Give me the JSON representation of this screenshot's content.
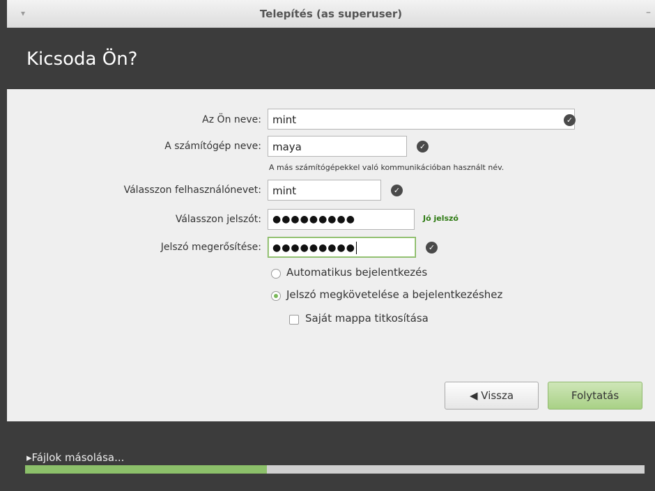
{
  "window": {
    "title": "Telepítés (as superuser)",
    "minimize_glyph": "–",
    "menu_glyph": "▾"
  },
  "header": {
    "heading": "Kicsoda Ön?"
  },
  "form": {
    "name_label": "Az Ön neve:",
    "name_value": "mint",
    "computer_label": "A számítógép neve:",
    "computer_value": "maya",
    "computer_hint": "A más számítógépekkel való kommunikációban használt név.",
    "username_label": "Válasszon felhasználónevet:",
    "username_value": "mint",
    "password_label": "Válasszon jelszót:",
    "password_value": "●●●●●●●●●",
    "password_strength": "Jó jelszó",
    "confirm_label": "Jelszó megerősítése:",
    "confirm_value": "●●●●●●●●●"
  },
  "options": {
    "auto_login": "Automatikus bejelentkezés",
    "require_password": "Jelszó megkövetelése a bejelentkezéshez",
    "encrypt_home": "Saját mappa titkosítása",
    "selected": "require_password",
    "encrypt_checked": false
  },
  "buttons": {
    "back": "Vissza",
    "back_icon": "◀",
    "continue": "Folytatás"
  },
  "footer": {
    "status": "▸Fájlok másolása...",
    "progress": 0.39
  },
  "colors": {
    "accent_green": "#8cc06a",
    "strength_green": "#2d7a12",
    "dark_bg": "#3c3c3c"
  }
}
